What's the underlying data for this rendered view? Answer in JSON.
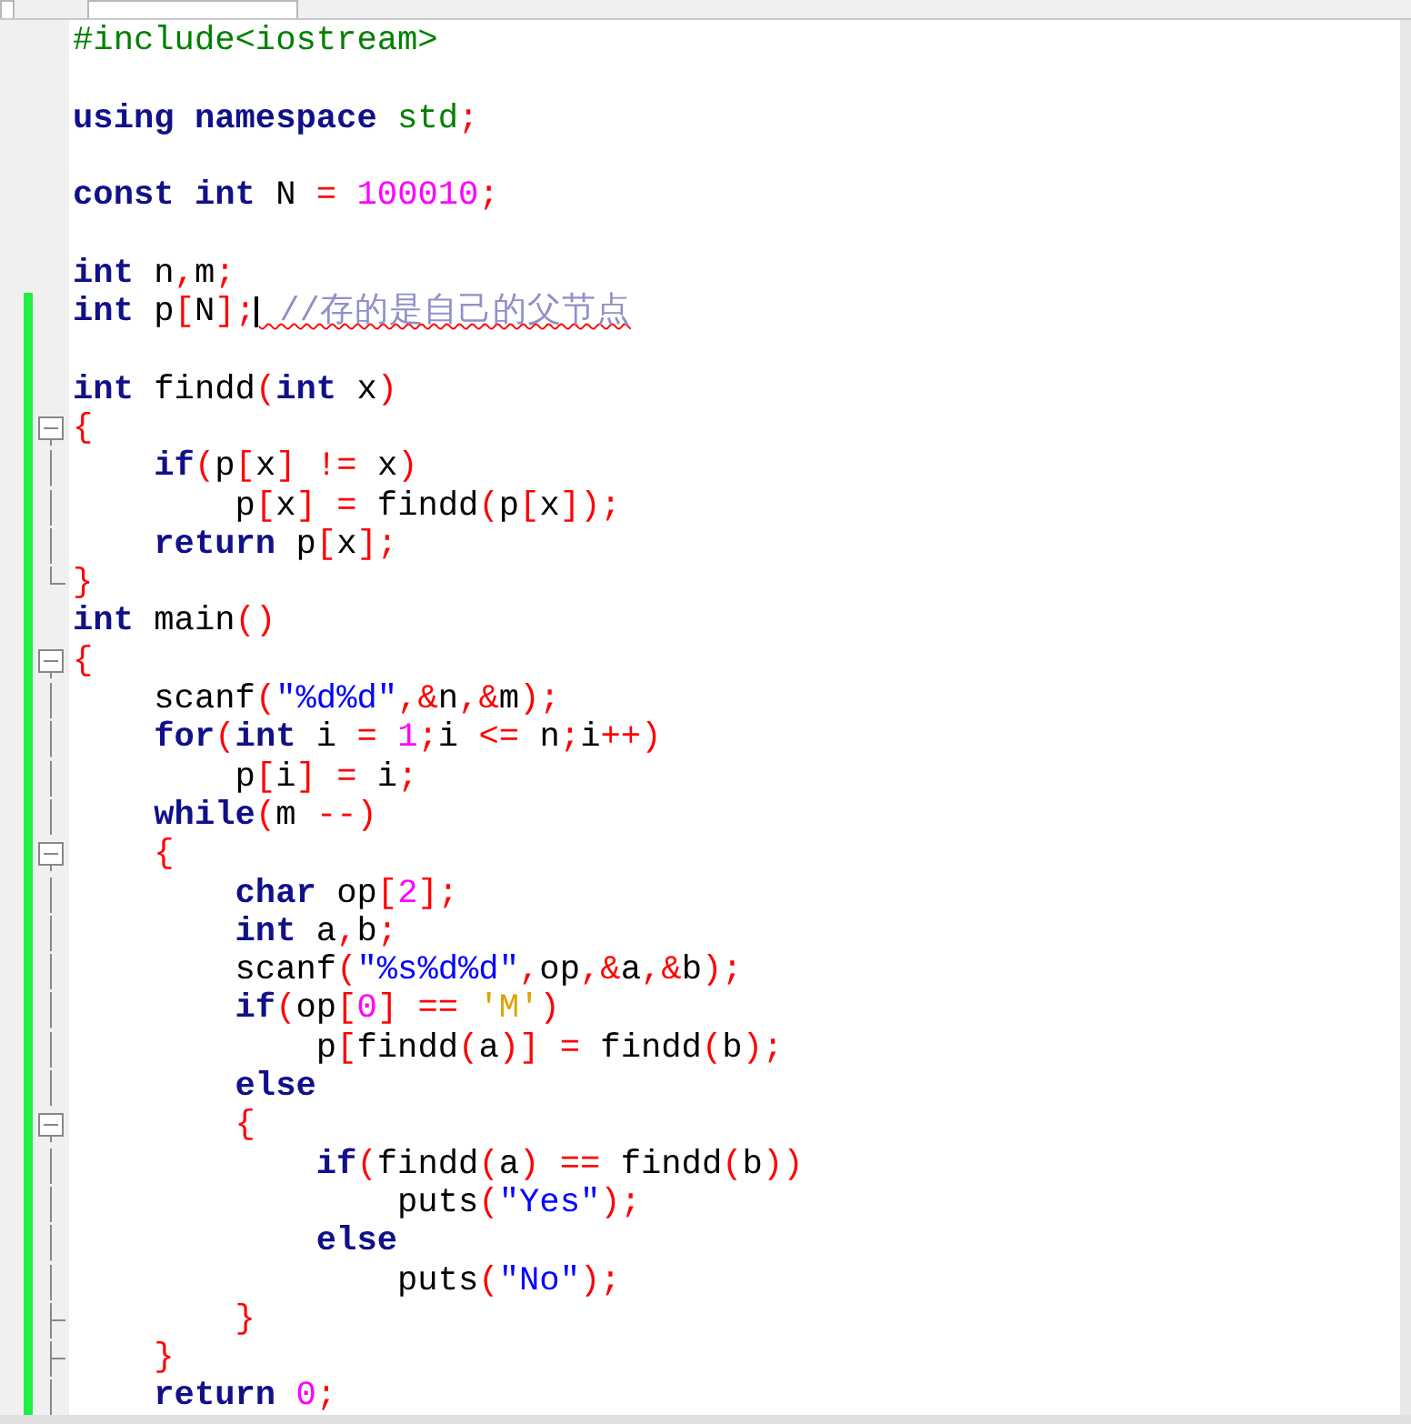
{
  "editor": {
    "lines": [
      {
        "modified": false,
        "tokens": [
          {
            "kind": "preprocessor",
            "text": "#include<iostream>"
          }
        ]
      },
      {
        "modified": false
      },
      {
        "modified": false,
        "tokens": [
          {
            "kind": "keyword",
            "text": "using "
          },
          {
            "kind": "keyword",
            "text": "namespace "
          },
          {
            "kind": "type",
            "text": "std"
          },
          {
            "kind": "symbol",
            "text": ";"
          }
        ]
      },
      {
        "modified": false
      },
      {
        "modified": false,
        "tokens": [
          {
            "kind": "keyword",
            "text": "const "
          },
          {
            "kind": "keyword",
            "text": "int"
          },
          {
            "kind": "plain",
            "text": " N "
          },
          {
            "kind": "symbol",
            "text": "= "
          },
          {
            "kind": "number",
            "text": "100010"
          },
          {
            "kind": "symbol",
            "text": ";"
          }
        ]
      },
      {
        "modified": false
      },
      {
        "modified": false,
        "tokens": [
          {
            "kind": "keyword",
            "text": "int"
          },
          {
            "kind": "plain",
            "text": " n"
          },
          {
            "kind": "symbol",
            "text": ","
          },
          {
            "kind": "plain",
            "text": "m"
          },
          {
            "kind": "symbol",
            "text": ";"
          }
        ]
      },
      {
        "modified": true,
        "tokens": [
          {
            "kind": "keyword",
            "text": "int"
          },
          {
            "kind": "plain",
            "text": " p"
          },
          {
            "kind": "symbol",
            "text": "["
          },
          {
            "kind": "plain",
            "text": "N"
          },
          {
            "kind": "symbol",
            "text": "];"
          },
          {
            "kind": "caret"
          },
          {
            "kind": "comment",
            "text": " //存的是自己的父节点",
            "misspelled": true
          }
        ]
      },
      {
        "modified": true
      },
      {
        "modified": true,
        "tokens": [
          {
            "kind": "keyword",
            "text": "int"
          },
          {
            "kind": "plain",
            "text": " findd"
          },
          {
            "kind": "symbol",
            "text": "("
          },
          {
            "kind": "keyword",
            "text": "int"
          },
          {
            "kind": "plain",
            "text": " x"
          },
          {
            "kind": "symbol",
            "text": ")"
          }
        ]
      },
      {
        "modified": true,
        "fold": {
          "kind": "start"
        },
        "tokens": [
          {
            "kind": "symbol",
            "text": "{"
          }
        ]
      },
      {
        "modified": true,
        "fold": {
          "kind": "line"
        },
        "tokens": [
          {
            "kind": "keyword",
            "text": "    if"
          },
          {
            "kind": "symbol",
            "text": "("
          },
          {
            "kind": "plain",
            "text": "p"
          },
          {
            "kind": "symbol",
            "text": "["
          },
          {
            "kind": "plain",
            "text": "x"
          },
          {
            "kind": "symbol",
            "text": "] !="
          },
          {
            "kind": "plain",
            "text": " x"
          },
          {
            "kind": "symbol",
            "text": ")"
          }
        ]
      },
      {
        "modified": true,
        "fold": {
          "kind": "line"
        },
        "tokens": [
          {
            "kind": "plain",
            "text": "        p"
          },
          {
            "kind": "symbol",
            "text": "["
          },
          {
            "kind": "plain",
            "text": "x"
          },
          {
            "kind": "symbol",
            "text": "] ="
          },
          {
            "kind": "plain",
            "text": " findd"
          },
          {
            "kind": "symbol",
            "text": "("
          },
          {
            "kind": "plain",
            "text": "p"
          },
          {
            "kind": "symbol",
            "text": "["
          },
          {
            "kind": "plain",
            "text": "x"
          },
          {
            "kind": "symbol",
            "text": "]);"
          }
        ]
      },
      {
        "modified": true,
        "fold": {
          "kind": "line"
        },
        "tokens": [
          {
            "kind": "keyword",
            "text": "    return"
          },
          {
            "kind": "plain",
            "text": " p"
          },
          {
            "kind": "symbol",
            "text": "["
          },
          {
            "kind": "plain",
            "text": "x"
          },
          {
            "kind": "symbol",
            "text": "];"
          }
        ]
      },
      {
        "modified": true,
        "fold": {
          "kind": "end"
        },
        "tokens": [
          {
            "kind": "symbol",
            "text": "}"
          }
        ]
      },
      {
        "modified": true,
        "tokens": [
          {
            "kind": "keyword",
            "text": "int"
          },
          {
            "kind": "plain",
            "text": " main"
          },
          {
            "kind": "symbol",
            "text": "()"
          }
        ]
      },
      {
        "modified": true,
        "fold": {
          "kind": "start"
        },
        "tokens": [
          {
            "kind": "symbol",
            "text": "{"
          }
        ]
      },
      {
        "modified": true,
        "fold": {
          "kind": "line"
        },
        "tokens": [
          {
            "kind": "plain",
            "text": "    scanf"
          },
          {
            "kind": "symbol",
            "text": "("
          },
          {
            "kind": "string",
            "text": "\"%d%d\""
          },
          {
            "kind": "symbol",
            "text": ",&"
          },
          {
            "kind": "plain",
            "text": "n"
          },
          {
            "kind": "symbol",
            "text": ",&"
          },
          {
            "kind": "plain",
            "text": "m"
          },
          {
            "kind": "symbol",
            "text": ");"
          }
        ]
      },
      {
        "modified": true,
        "fold": {
          "kind": "line"
        },
        "tokens": [
          {
            "kind": "keyword",
            "text": "    for"
          },
          {
            "kind": "symbol",
            "text": "("
          },
          {
            "kind": "keyword",
            "text": "int"
          },
          {
            "kind": "plain",
            "text": " i "
          },
          {
            "kind": "symbol",
            "text": "= "
          },
          {
            "kind": "number",
            "text": "1"
          },
          {
            "kind": "symbol",
            "text": ";"
          },
          {
            "kind": "plain",
            "text": "i "
          },
          {
            "kind": "symbol",
            "text": "<="
          },
          {
            "kind": "plain",
            "text": " n"
          },
          {
            "kind": "symbol",
            "text": ";"
          },
          {
            "kind": "plain",
            "text": "i"
          },
          {
            "kind": "symbol",
            "text": "++)"
          }
        ]
      },
      {
        "modified": true,
        "fold": {
          "kind": "line"
        },
        "tokens": [
          {
            "kind": "plain",
            "text": "        p"
          },
          {
            "kind": "symbol",
            "text": "["
          },
          {
            "kind": "plain",
            "text": "i"
          },
          {
            "kind": "symbol",
            "text": "] ="
          },
          {
            "kind": "plain",
            "text": " i"
          },
          {
            "kind": "symbol",
            "text": ";"
          }
        ]
      },
      {
        "modified": true,
        "fold": {
          "kind": "line"
        },
        "tokens": [
          {
            "kind": "keyword",
            "text": "    while"
          },
          {
            "kind": "symbol",
            "text": "("
          },
          {
            "kind": "plain",
            "text": "m "
          },
          {
            "kind": "symbol",
            "text": "--)"
          }
        ]
      },
      {
        "modified": true,
        "fold": {
          "kind": "start"
        },
        "tokens": [
          {
            "kind": "symbol",
            "text": "    {"
          }
        ]
      },
      {
        "modified": true,
        "fold": {
          "kind": "line"
        },
        "tokens": [
          {
            "kind": "keyword",
            "text": "        char"
          },
          {
            "kind": "plain",
            "text": " op"
          },
          {
            "kind": "symbol",
            "text": "["
          },
          {
            "kind": "number",
            "text": "2"
          },
          {
            "kind": "symbol",
            "text": "];"
          }
        ]
      },
      {
        "modified": true,
        "fold": {
          "kind": "line"
        },
        "tokens": [
          {
            "kind": "keyword",
            "text": "        int"
          },
          {
            "kind": "plain",
            "text": " a"
          },
          {
            "kind": "symbol",
            "text": ","
          },
          {
            "kind": "plain",
            "text": "b"
          },
          {
            "kind": "symbol",
            "text": ";"
          }
        ]
      },
      {
        "modified": true,
        "fold": {
          "kind": "line"
        },
        "tokens": [
          {
            "kind": "plain",
            "text": "        scanf"
          },
          {
            "kind": "symbol",
            "text": "("
          },
          {
            "kind": "string",
            "text": "\"%s%d%d\""
          },
          {
            "kind": "symbol",
            "text": ","
          },
          {
            "kind": "plain",
            "text": "op"
          },
          {
            "kind": "symbol",
            "text": ",&"
          },
          {
            "kind": "plain",
            "text": "a"
          },
          {
            "kind": "symbol",
            "text": ",&"
          },
          {
            "kind": "plain",
            "text": "b"
          },
          {
            "kind": "symbol",
            "text": ");"
          }
        ]
      },
      {
        "modified": true,
        "fold": {
          "kind": "line"
        },
        "tokens": [
          {
            "kind": "keyword",
            "text": "        if"
          },
          {
            "kind": "symbol",
            "text": "("
          },
          {
            "kind": "plain",
            "text": "op"
          },
          {
            "kind": "symbol",
            "text": "["
          },
          {
            "kind": "number",
            "text": "0"
          },
          {
            "kind": "symbol",
            "text": "] =="
          },
          {
            "kind": "char",
            "text": " 'M'"
          },
          {
            "kind": "symbol",
            "text": ")"
          }
        ]
      },
      {
        "modified": true,
        "fold": {
          "kind": "line"
        },
        "tokens": [
          {
            "kind": "plain",
            "text": "            p"
          },
          {
            "kind": "symbol",
            "text": "["
          },
          {
            "kind": "plain",
            "text": "findd"
          },
          {
            "kind": "symbol",
            "text": "("
          },
          {
            "kind": "plain",
            "text": "a"
          },
          {
            "kind": "symbol",
            "text": ")] ="
          },
          {
            "kind": "plain",
            "text": " findd"
          },
          {
            "kind": "symbol",
            "text": "("
          },
          {
            "kind": "plain",
            "text": "b"
          },
          {
            "kind": "symbol",
            "text": ");"
          }
        ]
      },
      {
        "modified": true,
        "fold": {
          "kind": "line"
        },
        "tokens": [
          {
            "kind": "keyword",
            "text": "        else"
          }
        ]
      },
      {
        "modified": true,
        "fold": {
          "kind": "start"
        },
        "tokens": [
          {
            "kind": "symbol",
            "text": "        {"
          }
        ]
      },
      {
        "modified": true,
        "fold": {
          "kind": "line"
        },
        "tokens": [
          {
            "kind": "keyword",
            "text": "            if"
          },
          {
            "kind": "symbol",
            "text": "("
          },
          {
            "kind": "plain",
            "text": "findd"
          },
          {
            "kind": "symbol",
            "text": "("
          },
          {
            "kind": "plain",
            "text": "a"
          },
          {
            "kind": "symbol",
            "text": ") =="
          },
          {
            "kind": "plain",
            "text": " findd"
          },
          {
            "kind": "symbol",
            "text": "("
          },
          {
            "kind": "plain",
            "text": "b"
          },
          {
            "kind": "symbol",
            "text": "))"
          }
        ]
      },
      {
        "modified": true,
        "fold": {
          "kind": "line"
        },
        "tokens": [
          {
            "kind": "plain",
            "text": "                puts"
          },
          {
            "kind": "symbol",
            "text": "("
          },
          {
            "kind": "string",
            "text": "\"Yes\""
          },
          {
            "kind": "symbol",
            "text": ");"
          }
        ]
      },
      {
        "modified": true,
        "fold": {
          "kind": "line"
        },
        "tokens": [
          {
            "kind": "keyword",
            "text": "            else"
          }
        ]
      },
      {
        "modified": true,
        "fold": {
          "kind": "line"
        },
        "tokens": [
          {
            "kind": "plain",
            "text": "                puts"
          },
          {
            "kind": "symbol",
            "text": "("
          },
          {
            "kind": "string",
            "text": "\"No\""
          },
          {
            "kind": "symbol",
            "text": ");"
          }
        ]
      },
      {
        "modified": true,
        "fold": {
          "kind": "tee"
        },
        "tokens": [
          {
            "kind": "symbol",
            "text": "        }"
          }
        ]
      },
      {
        "modified": true,
        "fold": {
          "kind": "tee"
        },
        "tokens": [
          {
            "kind": "symbol",
            "text": "    }"
          }
        ]
      },
      {
        "modified": true,
        "fold": {
          "kind": "line"
        },
        "tokens": [
          {
            "kind": "keyword",
            "text": "    return"
          },
          {
            "kind": "number",
            "text": " 0"
          },
          {
            "kind": "symbol",
            "text": ";"
          }
        ]
      }
    ]
  }
}
